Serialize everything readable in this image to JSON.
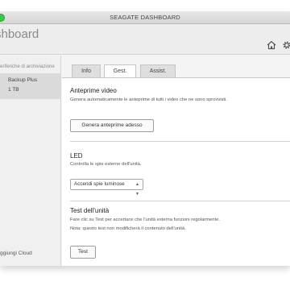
{
  "window": {
    "title": "SEAGATE DASHBOARD"
  },
  "header": {
    "app_title": "shboard",
    "icons": [
      "home-icon",
      "gear-icon"
    ]
  },
  "sidebar": {
    "heading": "eriferiche di archiviazione",
    "device": {
      "name": "Backup Plus",
      "size": "1 TB"
    },
    "footer": "ggiungi Cloud"
  },
  "tabs": [
    {
      "label": "Info",
      "active": false
    },
    {
      "label": "Gest.",
      "active": true
    },
    {
      "label": "Assist.",
      "active": false
    }
  ],
  "sections": {
    "previews": {
      "title": "Anteprime video",
      "desc": "Genera automaticamente le anteprime di tutti i video che ne sono sprovvisti.",
      "button": "Genera anteprime adesso"
    },
    "led": {
      "title": "LED",
      "desc": "Controlla le spie esterne dell'unità.",
      "select_value": "Accendi spie luminose"
    },
    "test": {
      "title": "Test dell'unità",
      "desc": "Fare clic su Test per accertarsi che l'unità esterna funzioni regolarmente.",
      "note": "Nota: questo test non modificherà il contenuto dell'unità.",
      "button": "Test"
    }
  },
  "colors": {
    "traffic_green": "#3cc64a",
    "sidebar_selected": "#dadada",
    "panel_bg": "#ffffff"
  }
}
